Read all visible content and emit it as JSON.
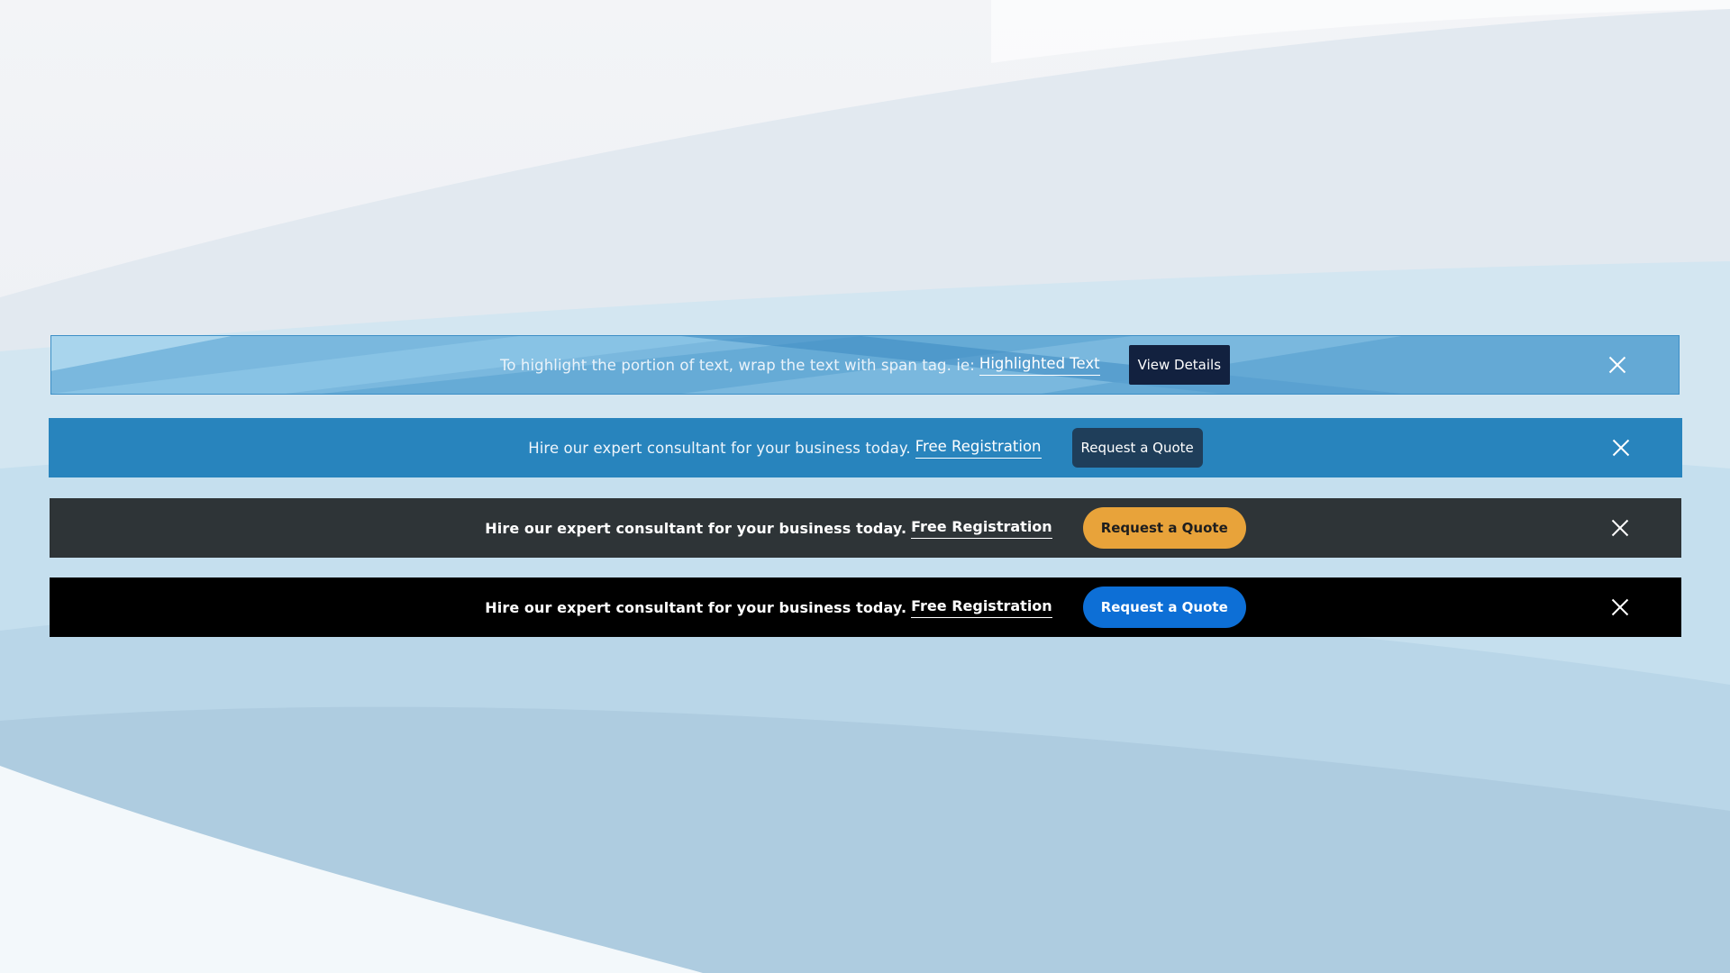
{
  "page": {
    "background_colors": [
      "#eef0f4",
      "#cfe3ef",
      "#a9c8dc"
    ]
  },
  "bars": [
    {
      "message": "To highlight the portion of text, wrap the text with span tag. ie:",
      "link_label": "Highlighted Text",
      "button_label": "View Details",
      "close_icon": "close-icon",
      "background": "#6fb0d8",
      "button_color": "#12213f"
    },
    {
      "message": "Hire our expert consultant for your business today.",
      "link_label": "Free Registration",
      "button_label": "Request a Quote",
      "close_icon": "close-icon",
      "background": "#2884bd",
      "button_color": "#1f3e5a"
    },
    {
      "message": "Hire our expert consultant for your business today.",
      "link_label": "Free Registration",
      "button_label": "Request a Quote",
      "close_icon": "close-icon",
      "background": "#2e3437",
      "button_color": "#e8a33a"
    },
    {
      "message": "Hire our expert consultant for your business today.",
      "link_label": "Free Registration",
      "button_label": "Request a Quote",
      "close_icon": "close-icon",
      "background": "#000000",
      "button_color": "#0d6fd6"
    }
  ]
}
